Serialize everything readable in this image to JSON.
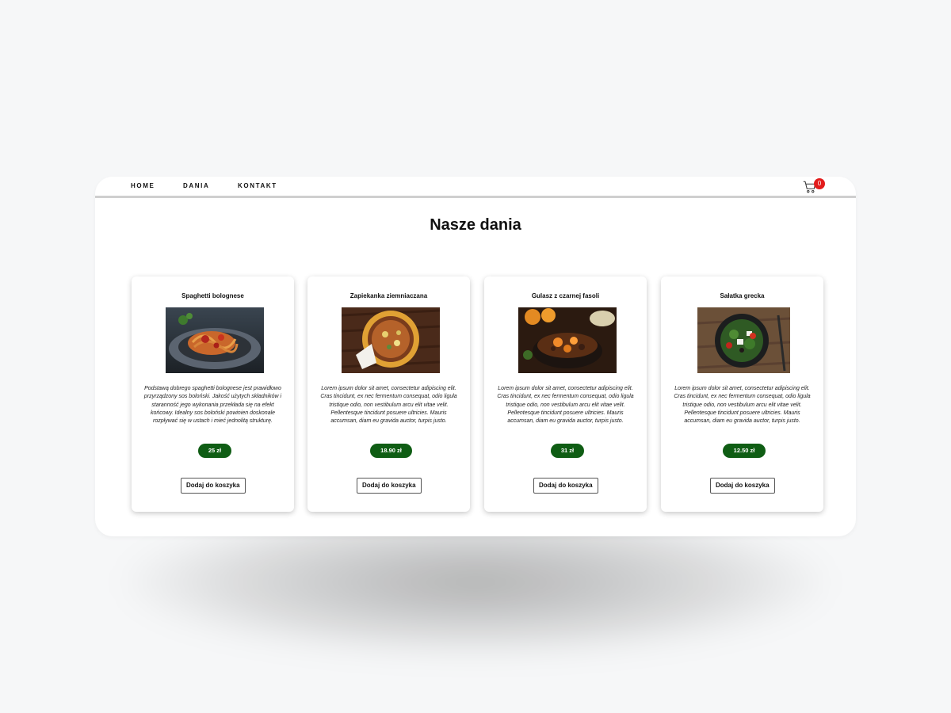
{
  "nav": {
    "links": [
      "HOME",
      "DANIA",
      "KONTAKT"
    ],
    "cart_icon": "shopping-cart-icon",
    "cart_count": "0"
  },
  "main": {
    "title": "Nasze dania",
    "add_to_cart_label": "Dodaj do koszyka"
  },
  "dishes": [
    {
      "name": "Spaghetti bolognese",
      "description": "Podstawą dobrego spaghetti bolognese jest prawidłowo przyrządzony sos boloński. Jakość użytych składników i staranność jego wykonania przekłada się na efekt końcowy. Idealny sos boloński powinien doskonale rozpływać się w ustach i mieć jednolitą strukturę.",
      "price": "25 zł"
    },
    {
      "name": "Zapiekanka ziemniaczana",
      "description": "Lorem ipsum dolor sit amet, consectetur adipiscing elit. Cras tincidunt, ex nec fermentum consequat, odio ligula tristique odio, non vestibulum arcu elit vitae velit. Pellentesque tincidunt posuere ultricies. Mauris accumsan, diam eu gravida auctor, turpis justo.",
      "price": "18.90 zł"
    },
    {
      "name": "Gulasz z czarnej fasoli",
      "description": "Lorem ipsum dolor sit amet, consectetur adipiscing elit. Cras tincidunt, ex nec fermentum consequat, odio ligula tristique odio, non vestibulum arcu elit vitae velit. Pellentesque tincidunt posuere ultricies. Mauris accumsan, diam eu gravida auctor, turpis justo.",
      "price": "31 zł"
    },
    {
      "name": "Sałatka grecka",
      "description": "Lorem ipsum dolor sit amet, consectetur adipiscing elit. Cras tincidunt, ex nec fermentum consequat, odio ligula tristique odio, non vestibulum arcu elit vitae velit. Pellentesque tincidunt posuere ultricies. Mauris accumsan, diam eu gravida auctor, turpis justo.",
      "price": "12.50 zł"
    }
  ],
  "colors": {
    "price_badge": "#0f5d14",
    "cart_badge": "#e21b1b",
    "page_background": "#f6f7f8"
  }
}
